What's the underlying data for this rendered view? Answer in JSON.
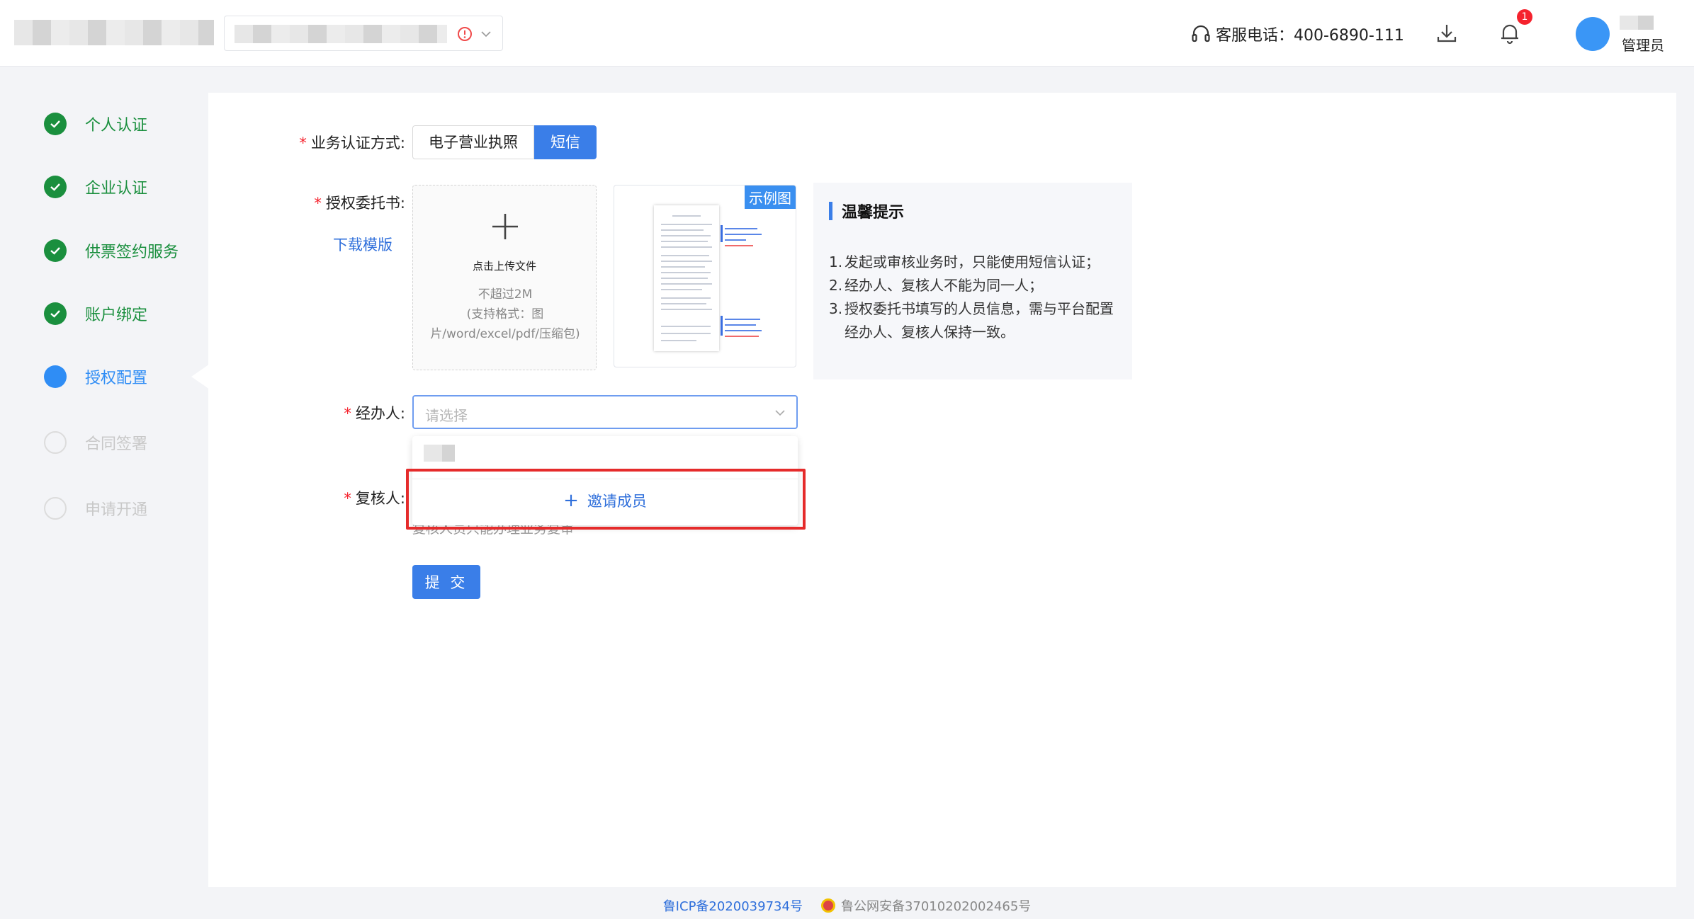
{
  "header": {
    "hotline_label": "客服电话：400-6890-111",
    "notification_count": "1",
    "user_role": "管理员"
  },
  "steps": [
    {
      "label": "个人认证",
      "state": "done"
    },
    {
      "label": "企业认证",
      "state": "done"
    },
    {
      "label": "供票签约服务",
      "state": "done"
    },
    {
      "label": "账户绑定",
      "state": "done"
    },
    {
      "label": "授权配置",
      "state": "active"
    },
    {
      "label": "合同签署",
      "state": "todo"
    },
    {
      "label": "申请开通",
      "state": "todo"
    }
  ],
  "form": {
    "auth_method": {
      "label": "业务认证方式:",
      "options": [
        "电子营业执照",
        "短信"
      ],
      "selected": "短信"
    },
    "authorization": {
      "label": "授权委托书:",
      "download_link": "下载模版",
      "upload_title": "点击上传文件",
      "upload_size": "不超过2M",
      "upload_formats": "(支持格式：图片/word/excel/pdf/压缩包)",
      "sample_tag": "示例图"
    },
    "operator": {
      "label": "经办人:",
      "placeholder": "请选择",
      "invite_label": "邀请成员"
    },
    "reviewer": {
      "label": "复核人:",
      "help": "复核人员只能办理业务复审"
    },
    "submit_label": "提 交"
  },
  "tips": {
    "title": "温馨提示",
    "items": [
      {
        "n": "1.",
        "text": "发起或审核业务时，只能使用短信认证；"
      },
      {
        "n": "2.",
        "text": "经办人、复核人不能为同一人；"
      },
      {
        "n": "3.",
        "text": "授权委托书填写的人员信息，需与平台配置经办人、复核人保持一致。"
      }
    ]
  },
  "footer": {
    "icp": "鲁ICP备2020039734号",
    "police": "鲁公网安备37010202002465号"
  },
  "colors": {
    "primary": "#3a7ee8",
    "done": "#1a8f3e",
    "active": "#2f8df5",
    "highlight": "#e52b2b"
  }
}
